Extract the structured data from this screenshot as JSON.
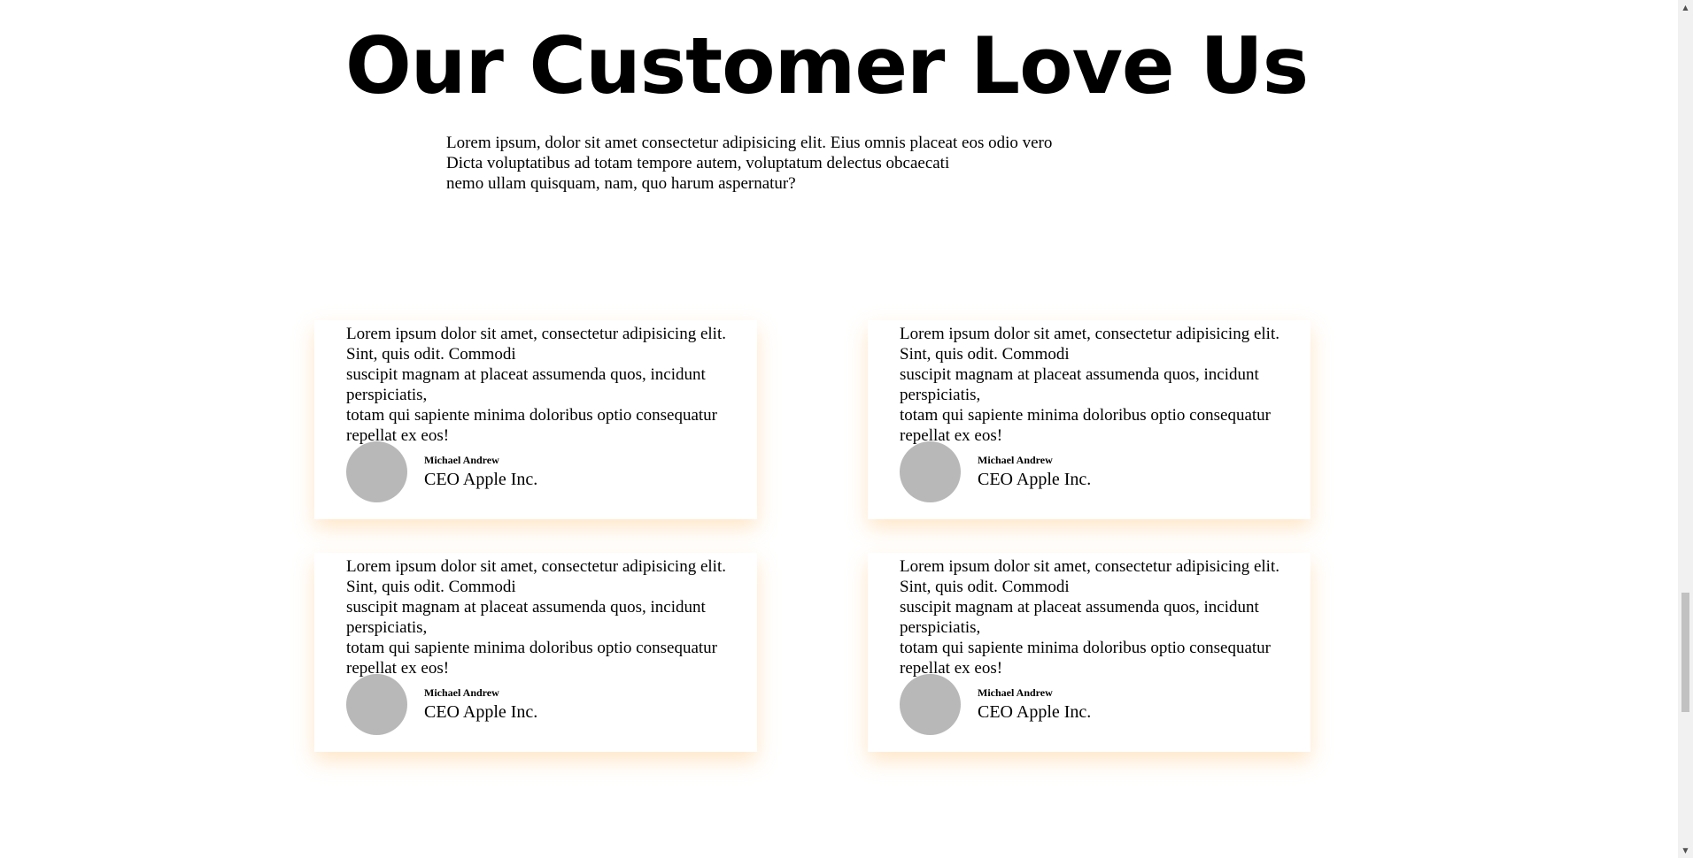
{
  "section": {
    "title": "Our Customer Love Us",
    "intro_lines": [
      "Lorem ipsum, dolor sit amet consectetur adipisicing elit. Eius omnis placeat eos odio vero",
      "Dicta voluptatibus ad totam tempore autem, voluptatum delectus obcaecati",
      "nemo ullam quisquam, nam, quo harum aspernatur?"
    ]
  },
  "testimonials": [
    {
      "lines": [
        "Lorem ipsum dolor sit amet, consectetur adipisicing elit.",
        "Sint, quis odit. Commodi",
        "suscipit magnam at placeat assumenda quos, incidunt",
        "perspiciatis,",
        "totam qui sapiente minima doloribus optio consequatur",
        "repellat ex eos!"
      ],
      "name": "Michael Andrew",
      "role": "CEO Apple Inc."
    },
    {
      "lines": [
        "Lorem ipsum dolor sit amet, consectetur adipisicing elit.",
        "Sint, quis odit. Commodi",
        "suscipit magnam at placeat assumenda quos, incidunt",
        "perspiciatis,",
        "totam qui sapiente minima doloribus optio consequatur",
        "repellat ex eos!"
      ],
      "name": "Michael Andrew",
      "role": "CEO Apple Inc."
    },
    {
      "lines": [
        "Lorem ipsum dolor sit amet, consectetur adipisicing elit.",
        "Sint, quis odit. Commodi",
        "suscipit magnam at placeat assumenda quos, incidunt",
        "perspiciatis,",
        "totam qui sapiente minima doloribus optio consequatur",
        "repellat ex eos!"
      ],
      "name": "Michael Andrew",
      "role": "CEO Apple Inc."
    },
    {
      "lines": [
        "Lorem ipsum dolor sit amet, consectetur adipisicing elit.",
        "Sint, quis odit. Commodi",
        "suscipit magnam at placeat assumenda quos, incidunt",
        "perspiciatis,",
        "totam qui sapiente minima doloribus optio consequatur",
        "repellat ex eos!"
      ],
      "name": "Michael Andrew",
      "role": "CEO Apple Inc."
    }
  ],
  "scrollbar": {
    "up_icon": "triangle-up-icon",
    "down_icon": "triangle-down-icon"
  }
}
